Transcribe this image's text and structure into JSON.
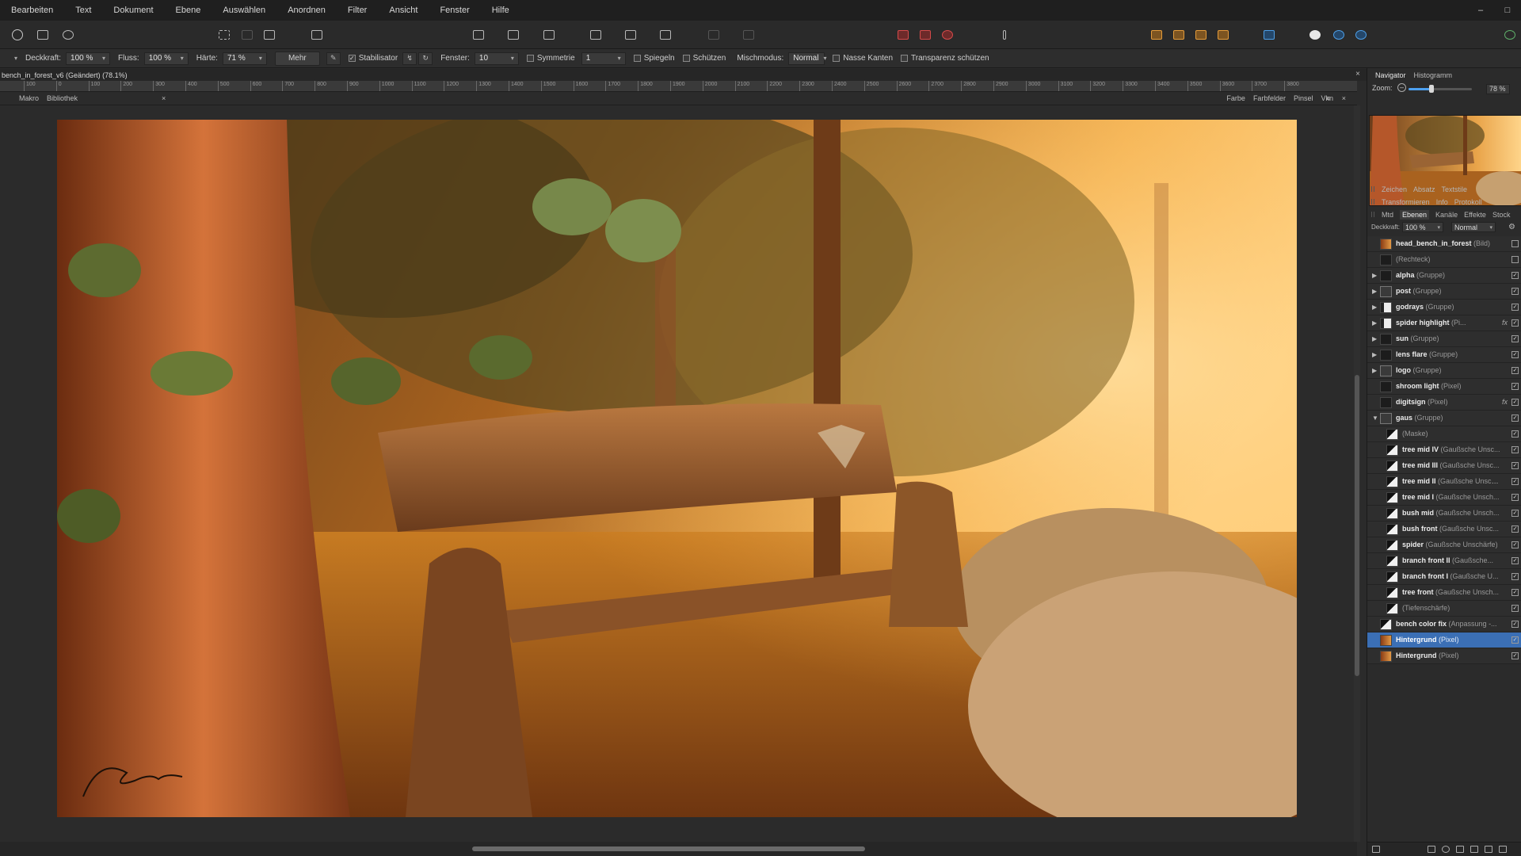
{
  "menu": [
    "Bearbeiten",
    "Text",
    "Dokument",
    "Ebene",
    "Auswählen",
    "Anordnen",
    "Filter",
    "Ansicht",
    "Fenster",
    "Hilfe"
  ],
  "window_controls": [
    "–",
    "□"
  ],
  "context": {
    "deckkraft_label": "Deckkraft:",
    "deckkraft_value": "100 %",
    "fluss_label": "Fluss:",
    "fluss_value": "100 %",
    "haerte_label": "Härte:",
    "haerte_value": "71 %",
    "mehr_label": "Mehr",
    "stabilisator_label": "Stabilisator",
    "fenster_label": "Fenster:",
    "fenster_value": "10",
    "symmetrie_label": "Symmetrie",
    "symmetrie_value": "1",
    "spiegeln_label": "Spiegeln",
    "schuetzen_label": "Schützen",
    "mischmodus_label": "Mischmodus:",
    "mischmodus_value": "Normal",
    "nasse_kanten_label": "Nasse Kanten",
    "transparenz_label": "Transparenz schützen"
  },
  "document": {
    "title": "bench_in_forest_v6 (Geändert) (78.1%)",
    "close": "×"
  },
  "ruler_ticks": [
    "100",
    "0",
    "100",
    "200",
    "300",
    "400",
    "500",
    "600",
    "700",
    "800",
    "900",
    "1000",
    "1100",
    "1200",
    "1300",
    "1400",
    "1500",
    "1600",
    "1700",
    "1800",
    "1900",
    "2000",
    "2100",
    "2200",
    "2300",
    "2400",
    "2500",
    "2600",
    "2700",
    "2800",
    "2900",
    "3000",
    "3100",
    "3200",
    "3300",
    "3400",
    "3500",
    "3600",
    "3700",
    "3800"
  ],
  "studio_left": [
    "Makro",
    "Bibliothek"
  ],
  "studio_left_close": "×",
  "studio_right": [
    "Farbe",
    "Farbfelder",
    "Pinsel",
    "Vkn"
  ],
  "studio_right_close": "×",
  "navigator": {
    "tabs": [
      "Navigator",
      "Histogramm"
    ],
    "zoom_label": "Zoom:",
    "zoom_value": "78 %",
    "zoom_fraction": 0.36
  },
  "panel_rows": {
    "row1": [
      "Zeichen",
      "Absatz",
      "Textstile"
    ],
    "row2": [
      "Transformieren",
      "Info",
      "Protokoll"
    ],
    "row3": [
      "Mtd",
      "Ebenen",
      "Kanäle",
      "Effekte",
      "Stock"
    ]
  },
  "layer_controls": {
    "deckkraft_label": "Deckkraft:",
    "deckkraft_value": "100 %",
    "blend_value": "Normal"
  },
  "layers": [
    {
      "name": "head_bench_in_forest",
      "type": "(Bild)",
      "expandable": false,
      "indent": 0,
      "visible": false,
      "fx": false,
      "thumb": "photo"
    },
    {
      "name": "",
      "type": "(Rechteck)",
      "expandable": false,
      "indent": 0,
      "visible": false,
      "fx": false,
      "thumb": "dark"
    },
    {
      "name": "alpha",
      "type": "(Gruppe)",
      "expandable": true,
      "indent": 0,
      "visible": true,
      "fx": false,
      "thumb": "dark"
    },
    {
      "name": "post",
      "type": "(Gruppe)",
      "expandable": true,
      "indent": 0,
      "visible": true,
      "fx": false,
      "thumb": "folder"
    },
    {
      "name": "godrays",
      "type": "(Gruppe)",
      "expandable": true,
      "indent": 0,
      "visible": true,
      "fx": false,
      "thumb": "white"
    },
    {
      "name": "spider highlight",
      "type": "(Pi...",
      "expandable": true,
      "indent": 0,
      "visible": true,
      "fx": true,
      "thumb": "white"
    },
    {
      "name": "sun",
      "type": "(Gruppe)",
      "expandable": true,
      "indent": 0,
      "visible": true,
      "fx": false,
      "thumb": "dark"
    },
    {
      "name": "lens flare",
      "type": "(Gruppe)",
      "expandable": true,
      "indent": 0,
      "visible": true,
      "fx": false,
      "thumb": "dark"
    },
    {
      "name": "logo",
      "type": "(Gruppe)",
      "expandable": true,
      "indent": 0,
      "visible": true,
      "fx": false,
      "thumb": "folder"
    },
    {
      "name": "shroom light",
      "type": "(Pixel)",
      "expandable": false,
      "indent": 0,
      "visible": true,
      "fx": false,
      "thumb": "dark"
    },
    {
      "name": "digitsign",
      "type": "(Pixel)",
      "expandable": false,
      "indent": 0,
      "visible": true,
      "fx": true,
      "thumb": "dark"
    },
    {
      "name": "gaus",
      "type": "(Gruppe)",
      "expandable": true,
      "expanded": true,
      "indent": 0,
      "visible": true,
      "fx": false,
      "thumb": "folder"
    },
    {
      "name": "",
      "type": "(Maske)",
      "expandable": false,
      "indent": 1,
      "visible": true,
      "fx": false,
      "thumb": "mask"
    },
    {
      "name": "tree mid IV",
      "type": "(Gaußsche Unsc...",
      "expandable": false,
      "indent": 1,
      "visible": true,
      "fx": false,
      "thumb": "mask"
    },
    {
      "name": "tree mid III",
      "type": "(Gaußsche Unsc...",
      "expandable": false,
      "indent": 1,
      "visible": true,
      "fx": false,
      "thumb": "mask"
    },
    {
      "name": "tree mid II",
      "type": "(Gaußsche Unsch...",
      "expandable": false,
      "indent": 1,
      "visible": true,
      "fx": false,
      "thumb": "mask"
    },
    {
      "name": "tree mid I",
      "type": "(Gaußsche Unsch...",
      "expandable": false,
      "indent": 1,
      "visible": true,
      "fx": false,
      "thumb": "mask"
    },
    {
      "name": "bush mid",
      "type": "(Gaußsche Unsch...",
      "expandable": false,
      "indent": 1,
      "visible": true,
      "fx": false,
      "thumb": "mask"
    },
    {
      "name": "bush front",
      "type": "(Gaußsche Unsc...",
      "expandable": false,
      "indent": 1,
      "visible": true,
      "fx": false,
      "thumb": "mask"
    },
    {
      "name": "spider",
      "type": "(Gaußsche Unschärfe)",
      "expandable": false,
      "indent": 1,
      "visible": true,
      "fx": false,
      "thumb": "mask"
    },
    {
      "name": "branch front II",
      "type": "(Gaußsche...",
      "expandable": false,
      "indent": 1,
      "visible": true,
      "fx": false,
      "thumb": "mask"
    },
    {
      "name": "branch front I",
      "type": "(Gaußsche U...",
      "expandable": false,
      "indent": 1,
      "visible": true,
      "fx": false,
      "thumb": "mask"
    },
    {
      "name": "tree front",
      "type": "(Gaußsche Unsch...",
      "expandable": false,
      "indent": 1,
      "visible": true,
      "fx": false,
      "thumb": "mask"
    },
    {
      "name": "",
      "type": "(Tiefenschärfe)",
      "expandable": false,
      "indent": 1,
      "visible": true,
      "fx": false,
      "thumb": "mask"
    },
    {
      "name": "bench color fix",
      "type": "(Anpassung -...",
      "expandable": false,
      "indent": 0,
      "visible": true,
      "fx": false,
      "thumb": "mask"
    },
    {
      "name": "Hintergrund",
      "type": "(Pixel)",
      "expandable": false,
      "indent": 0,
      "visible": true,
      "fx": false,
      "thumb": "photo",
      "selected": true
    },
    {
      "name": "Hintergrund",
      "type": "(Pixel)",
      "expandable": false,
      "indent": 0,
      "visible": true,
      "fx": false,
      "thumb": "photo"
    }
  ],
  "colors": {
    "accent": "#3b6fb5",
    "slider": "#4da0f0"
  }
}
